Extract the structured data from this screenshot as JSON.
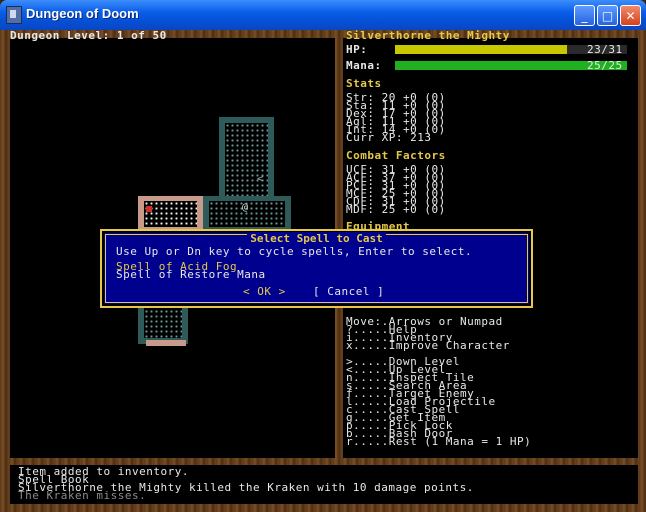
{
  "window": {
    "title": "Dungeon of Doom",
    "minimize": "_",
    "maximize": "□",
    "close": "✕"
  },
  "dungeon": {
    "level_label": "Dungeon Level: 1 of 50"
  },
  "character": {
    "name": "Silverthorne the Mighty",
    "hp_label": "HP:",
    "hp_value": "23/31",
    "hp_fraction": 0.742,
    "mana_label": "Mana:",
    "mana_value": "25/25",
    "mana_fraction": 1.0,
    "hp_color": "#c8c800",
    "mana_color": "#20b020"
  },
  "stats": {
    "header": "Stats",
    "lines": [
      "Str: 20 +0 (0)",
      "Sta: 11 +0 (0)",
      "Dex: 17 +0 (0)",
      "Agl: 11 +0 (0)",
      "Int: 14 +0 (0)",
      "Curr XP: 213"
    ]
  },
  "combat": {
    "header": "Combat Factors",
    "lines": [
      "UCF: 31 +0 (0)",
      "ACF: 37 +0 (0)",
      "PCF: 31 +0 (0)",
      "MCF: 25 +0 (0)",
      "CDF: 31 +0 (0)",
      "MDF: 25 +0 (0)"
    ]
  },
  "equipment": {
    "header": "Equipment"
  },
  "help": {
    "lines": [
      "Move:.Arrows or Numpad",
      "?.....Help",
      "i.....Inventory",
      "x.....Improve Character"
    ],
    "commands": [
      ">.....Down Level",
      "<.....Up Level",
      "n.....Inspect Tile",
      "s.....Search Area",
      "f.....Target Enemy",
      "l.....Load Projectile",
      "c.....Cast Spell",
      "g.....Get Item",
      "p.....Pick Lock",
      "b.....Bash Door",
      "r.....Rest (1 Mana = 1 HP)"
    ]
  },
  "dialog": {
    "title": "Select Spell to Cast",
    "instructions": "Use Up or Dn key to cycle spells, Enter to select.",
    "spells": [
      "Spell of Acid Fog",
      "Spell of Restore Mana"
    ],
    "ok": "< OK >",
    "cancel": "[ Cancel ]"
  },
  "messages": [
    "Item added to inventory.",
    "Spell Book",
    "Silverthorne the Mighty killed the Kraken with 10 damage points.",
    "The Kraken misses."
  ]
}
